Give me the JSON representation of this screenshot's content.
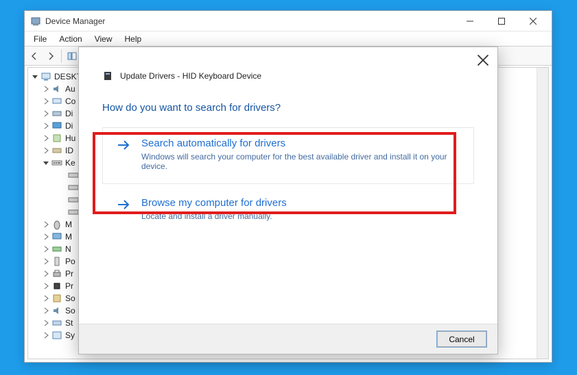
{
  "window": {
    "title": "Device Manager",
    "menu": {
      "file": "File",
      "action": "Action",
      "view": "View",
      "help": "Help"
    }
  },
  "tree": {
    "root": "DESKT",
    "items": [
      {
        "label": "Au",
        "icon": "audio"
      },
      {
        "label": "Co",
        "icon": "computer"
      },
      {
        "label": "Di",
        "icon": "disk"
      },
      {
        "label": "Di",
        "icon": "display"
      },
      {
        "label": "Hu",
        "icon": "hid"
      },
      {
        "label": "ID",
        "icon": "ide"
      }
    ],
    "keyboards": {
      "label": "Ke",
      "children": [
        "",
        "",
        "",
        ""
      ]
    },
    "more": [
      {
        "label": "M",
        "icon": "mouse"
      },
      {
        "label": "M",
        "icon": "monitor"
      },
      {
        "label": "N",
        "icon": "network"
      },
      {
        "label": "Po",
        "icon": "portable"
      },
      {
        "label": "Pr",
        "icon": "print"
      },
      {
        "label": "Pr",
        "icon": "processor"
      },
      {
        "label": "So",
        "icon": "software"
      },
      {
        "label": "So",
        "icon": "sound"
      },
      {
        "label": "St",
        "icon": "storage"
      },
      {
        "label": "Sy",
        "icon": "system"
      }
    ]
  },
  "dialog": {
    "title": "Update Drivers - HID Keyboard Device",
    "question": "How do you want to search for drivers?",
    "option1": {
      "title": "Search automatically for drivers",
      "desc": "Windows will search your computer for the best available driver and install it on your device."
    },
    "option2": {
      "title": "Browse my computer for drivers",
      "desc": "Locate and install a driver manually."
    },
    "cancel": "Cancel"
  }
}
